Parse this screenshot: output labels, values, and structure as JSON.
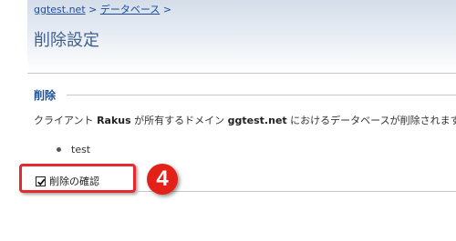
{
  "breadcrumb": {
    "domain_link": "ggtest.net",
    "sep1": ">",
    "database_link": "データベース",
    "sep2": ">"
  },
  "page": {
    "title": "削除設定"
  },
  "section": {
    "legend": "削除",
    "description_prefix": "クライアント ",
    "client_name": "Rakus",
    "description_middle": " が所有するドメイン ",
    "domain_name": "ggtest.net",
    "description_suffix": " におけるデータベースが削除されます:",
    "databases": [
      "test"
    ]
  },
  "confirm": {
    "label": "削除の確認",
    "checked": true
  },
  "annotation": {
    "step_number": "4"
  },
  "colors": {
    "highlight": "#e8282b",
    "badge": "#e32118",
    "title": "#3f5f8e",
    "link": "#1e4c9a"
  }
}
